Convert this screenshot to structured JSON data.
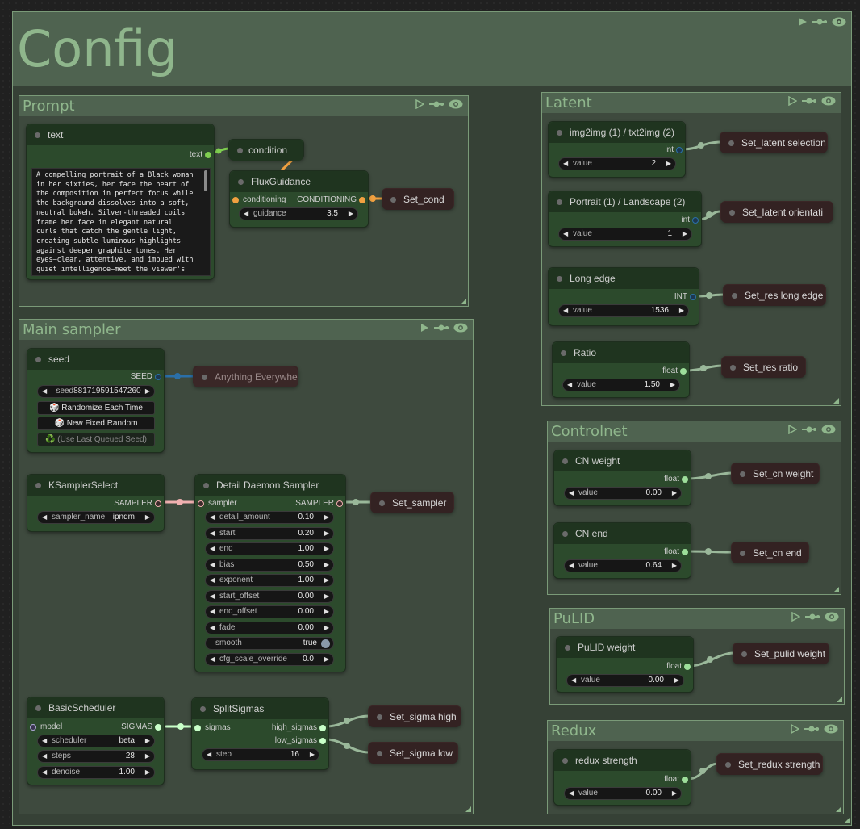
{
  "groups": {
    "config": {
      "title": "Config"
    },
    "prompt": {
      "title": "Prompt"
    },
    "main_sampler": {
      "title": "Main sampler"
    },
    "latent": {
      "title": "Latent"
    },
    "controlnet": {
      "title": "Controlnet"
    },
    "pulid": {
      "title": "PuLID"
    },
    "redux": {
      "title": "Redux"
    }
  },
  "icons": {
    "run": "play-icon",
    "bypass": "link-icon",
    "view": "eye-icon"
  },
  "prompt": {
    "text_node": {
      "title": "text",
      "output": "text",
      "text": "A compelling portrait of a Black woman in her sixties, her face the heart of the composition in perfect focus while the background dissolves into a soft, neutral bokeh. Silver-threaded coils frame her face in elegant natural curls that catch the gentle light, creating subtle luminous highlights against deeper graphite tones. Her eyes—clear, attentive, and imbued with quiet intelligence—meet the viewer's gaze directly, communicating decades of"
    },
    "condition_node": {
      "title": "condition"
    },
    "flux_node": {
      "title": "FluxGuidance",
      "input": "conditioning",
      "output": "CONDITIONING",
      "guidance_label": "guidance",
      "guidance_value": "3.5"
    },
    "set_cond": {
      "title": "Set_cond"
    }
  },
  "main": {
    "seed_node": {
      "title": "seed",
      "output": "SEED",
      "seed_label": "seed",
      "seed_value": "881719591547260",
      "randomize": "🎲 Randomize Each Time",
      "new_fixed": "🎲 New Fixed Random",
      "use_last": "♻️ (Use Last Queued Seed)"
    },
    "anything": {
      "title": "Anything Everywhere"
    },
    "ksampler_select": {
      "title": "KSamplerSelect",
      "output": "SAMPLER",
      "sampler_label": "sampler_name",
      "sampler_value": "ipndm"
    },
    "detail_daemon": {
      "title": "Detail Daemon Sampler",
      "input": "sampler",
      "output": "SAMPLER",
      "params": [
        {
          "label": "detail_amount",
          "value": "0.10"
        },
        {
          "label": "start",
          "value": "0.20"
        },
        {
          "label": "end",
          "value": "1.00"
        },
        {
          "label": "bias",
          "value": "0.50"
        },
        {
          "label": "exponent",
          "value": "1.00"
        },
        {
          "label": "start_offset",
          "value": "0.00"
        },
        {
          "label": "end_offset",
          "value": "0.00"
        },
        {
          "label": "fade",
          "value": "0.00"
        }
      ],
      "smooth_label": "smooth",
      "smooth_value": "true",
      "cfg_label": "cfg_scale_override",
      "cfg_value": "0.0"
    },
    "set_sampler": {
      "title": "Set_sampler"
    },
    "basic_scheduler": {
      "title": "BasicScheduler",
      "input": "model",
      "output": "SIGMAS",
      "scheduler_label": "scheduler",
      "scheduler_value": "beta",
      "steps_label": "steps",
      "steps_value": "28",
      "denoise_label": "denoise",
      "denoise_value": "1.00"
    },
    "split_sigmas": {
      "title": "SplitSigmas",
      "input": "sigmas",
      "output_high": "high_sigmas",
      "output_low": "low_sigmas",
      "step_label": "step",
      "step_value": "16"
    },
    "set_sigma_high": {
      "title": "Set_sigma high"
    },
    "set_sigma_low": {
      "title": "Set_sigma low"
    }
  },
  "latent": {
    "img2img": {
      "title": "img2img (1) / txt2img (2)",
      "output": "int",
      "value_label": "value",
      "value": "2"
    },
    "set_selection": {
      "title": "Set_latent selection"
    },
    "orientation": {
      "title": "Portrait (1) / Landscape (2)",
      "output": "int",
      "value_label": "value",
      "value": "1"
    },
    "set_orientation": {
      "title": "Set_latent orientati"
    },
    "long_edge": {
      "title": "Long edge",
      "output": "INT",
      "value_label": "value",
      "value": "1536"
    },
    "set_long_edge": {
      "title": "Set_res long edge"
    },
    "ratio": {
      "title": "Ratio",
      "output": "float",
      "value_label": "value",
      "value": "1.50"
    },
    "set_ratio": {
      "title": "Set_res ratio"
    }
  },
  "controlnet": {
    "cn_weight": {
      "title": "CN weight",
      "output": "float",
      "value_label": "value",
      "value": "0.00"
    },
    "set_cn_weight": {
      "title": "Set_cn weight"
    },
    "cn_end": {
      "title": "CN end",
      "output": "float",
      "value_label": "value",
      "value": "0.64"
    },
    "set_cn_end": {
      "title": "Set_cn end"
    }
  },
  "pulid": {
    "weight": {
      "title": "PuLID weight",
      "output": "float",
      "value_label": "value",
      "value": "0.00"
    },
    "set_weight": {
      "title": "Set_pulid weight"
    }
  },
  "redux": {
    "strength": {
      "title": "redux strength",
      "output": "float",
      "value_label": "value",
      "value": "0.00"
    },
    "set_strength": {
      "title": "Set_redux strength"
    }
  },
  "colors": {
    "group_border": "#7a9a78",
    "group_title": "#8fb68c",
    "node_body": "#2c4a2c",
    "float_socket": "#9dde9a",
    "int_socket": "#2a6fa8",
    "conditioning_socket": "#f0a040",
    "sampler_socket": "#f0b0b0"
  }
}
